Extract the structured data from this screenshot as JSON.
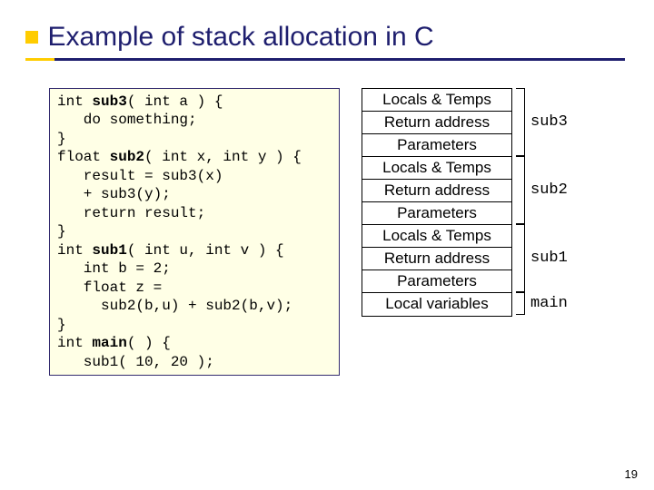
{
  "title": "Example of stack allocation in C",
  "code_lines": [
    {
      "t": "int ",
      "b": "sub3",
      "r": "( int a ) {"
    },
    {
      "t": "   do something;",
      "b": "",
      "r": ""
    },
    {
      "t": "}",
      "b": "",
      "r": ""
    },
    {
      "t": "float ",
      "b": "sub2",
      "r": "( int x, int y ) {"
    },
    {
      "t": "   result = sub3(x)",
      "b": "",
      "r": ""
    },
    {
      "t": "   + sub3(y);",
      "b": "",
      "r": ""
    },
    {
      "t": "   return result;",
      "b": "",
      "r": ""
    },
    {
      "t": "}",
      "b": "",
      "r": ""
    },
    {
      "t": "int ",
      "b": "sub1",
      "r": "( int u, int v ) {"
    },
    {
      "t": "   int b = 2;",
      "b": "",
      "r": ""
    },
    {
      "t": "   float z =",
      "b": "",
      "r": ""
    },
    {
      "t": "     sub2(b,u) + sub2(b,v);",
      "b": "",
      "r": ""
    },
    {
      "t": "}",
      "b": "",
      "r": ""
    },
    {
      "t": "int ",
      "b": "main",
      "r": "( ) {"
    },
    {
      "t": "   sub1( 10, 20 );",
      "b": "",
      "r": ""
    }
  ],
  "stack_cells": [
    "Locals & Temps",
    "Return address",
    "Parameters",
    "Locals & Temps",
    "Return address",
    "Parameters",
    "Locals & Temps",
    "Return address",
    "Parameters",
    "Local variables"
  ],
  "brackets": [
    {
      "label": "sub3",
      "rows": [
        0,
        2
      ]
    },
    {
      "label": "sub2",
      "rows": [
        3,
        5
      ]
    },
    {
      "label": "sub1",
      "rows": [
        6,
        8
      ]
    },
    {
      "label": "main",
      "rows": [
        9,
        9
      ]
    }
  ],
  "page_number": "19"
}
